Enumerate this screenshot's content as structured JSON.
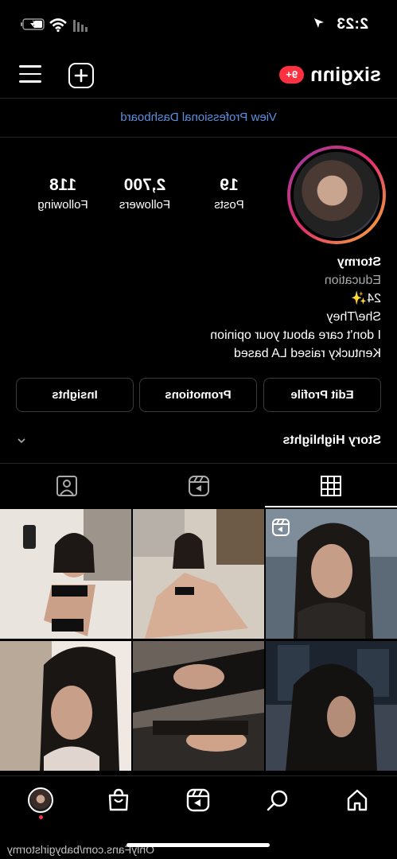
{
  "status_bar": {
    "time": "2:23",
    "icons": [
      "location-arrow-icon",
      "cellular-signal-icon",
      "wifi-icon",
      "battery-charging-icon"
    ]
  },
  "header": {
    "username": "sixginn",
    "notification_badge": "9+",
    "add_icon": "plus-square-icon",
    "menu_icon": "hamburger-menu-icon"
  },
  "dashboard_link": "View Professional Dashboard",
  "profile": {
    "stats": [
      {
        "value": "19",
        "label": "Posts"
      },
      {
        "value": "2,700",
        "label": "Followers"
      },
      {
        "value": "118",
        "label": "Following"
      }
    ],
    "name": "Stormy",
    "category": "Education",
    "bio_lines": [
      "24✨",
      "She/They",
      "I don't care about your opinion",
      "Kentucky raised LA based"
    ]
  },
  "actions": {
    "edit_profile": "Edit Profile",
    "promotions": "Promotions",
    "insights": "Insights"
  },
  "story_highlights": {
    "label": "Story Highlights",
    "chevron_icon": "chevron-down-icon"
  },
  "tabs": [
    {
      "name": "grid",
      "icon": "grid-icon",
      "active": true
    },
    {
      "name": "reels",
      "icon": "reels-icon",
      "active": false
    },
    {
      "name": "tagged",
      "icon": "tagged-person-icon",
      "active": false
    }
  ],
  "grid_posts": [
    {
      "kind": "reel"
    },
    {
      "kind": "photo"
    },
    {
      "kind": "photo"
    },
    {
      "kind": "photo"
    },
    {
      "kind": "photo"
    },
    {
      "kind": "photo"
    }
  ],
  "bottom_nav": {
    "items": [
      "home-icon",
      "search-icon",
      "reels-icon",
      "shop-icon",
      "profile-avatar"
    ],
    "active_indicator_color": "#ff3040"
  },
  "watermark": "OnlyFans.com/babygirlstormy",
  "colors": {
    "background": "#000000",
    "link": "#5a90e0",
    "badge": "#ff3040",
    "divider": "#262626"
  }
}
